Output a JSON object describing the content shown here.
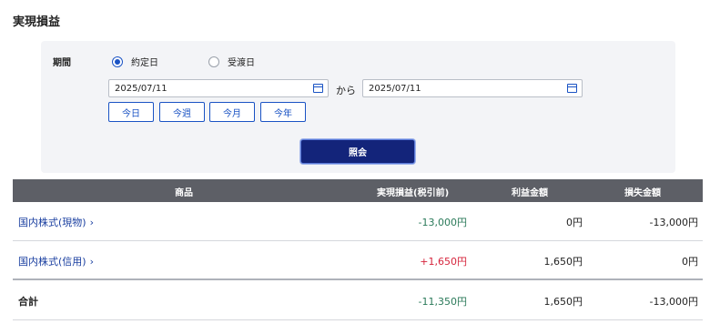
{
  "page_title": "実現損益",
  "filter": {
    "period_label": "期間",
    "radio_options": [
      {
        "label": "約定日",
        "checked": true
      },
      {
        "label": "受渡日",
        "checked": false
      }
    ],
    "date_from": "2025/07/11",
    "date_to": "2025/07/11",
    "separator": "から",
    "quick_buttons": [
      "今日",
      "今週",
      "今月",
      "今年"
    ],
    "submit_label": "照会"
  },
  "table": {
    "headers": [
      "商品",
      "実現損益(税引前)",
      "利益金額",
      "損失金額"
    ],
    "rows": [
      {
        "name": "国内株式(現物)",
        "chevron": "›",
        "realized": "-13,000円",
        "profit": "0円",
        "loss": "-13,000円",
        "sign": "negative"
      },
      {
        "name": "国内株式(信用)",
        "chevron": "›",
        "realized": "+1,650円",
        "profit": "1,650円",
        "loss": "0円",
        "sign": "positive"
      }
    ],
    "total": {
      "label": "合計",
      "realized": "-11,350円",
      "profit": "1,650円",
      "loss": "-13,000円"
    }
  },
  "colors": {
    "accent": "#1a53c4",
    "submit_bg": "#13247a",
    "header_bg": "#5d5f66",
    "negative": "#2b7a5a",
    "positive": "#d6243c",
    "link": "#1a3fa0"
  },
  "icons": {
    "calendar": "calendar-icon",
    "chevron": "chevron-right-icon"
  }
}
